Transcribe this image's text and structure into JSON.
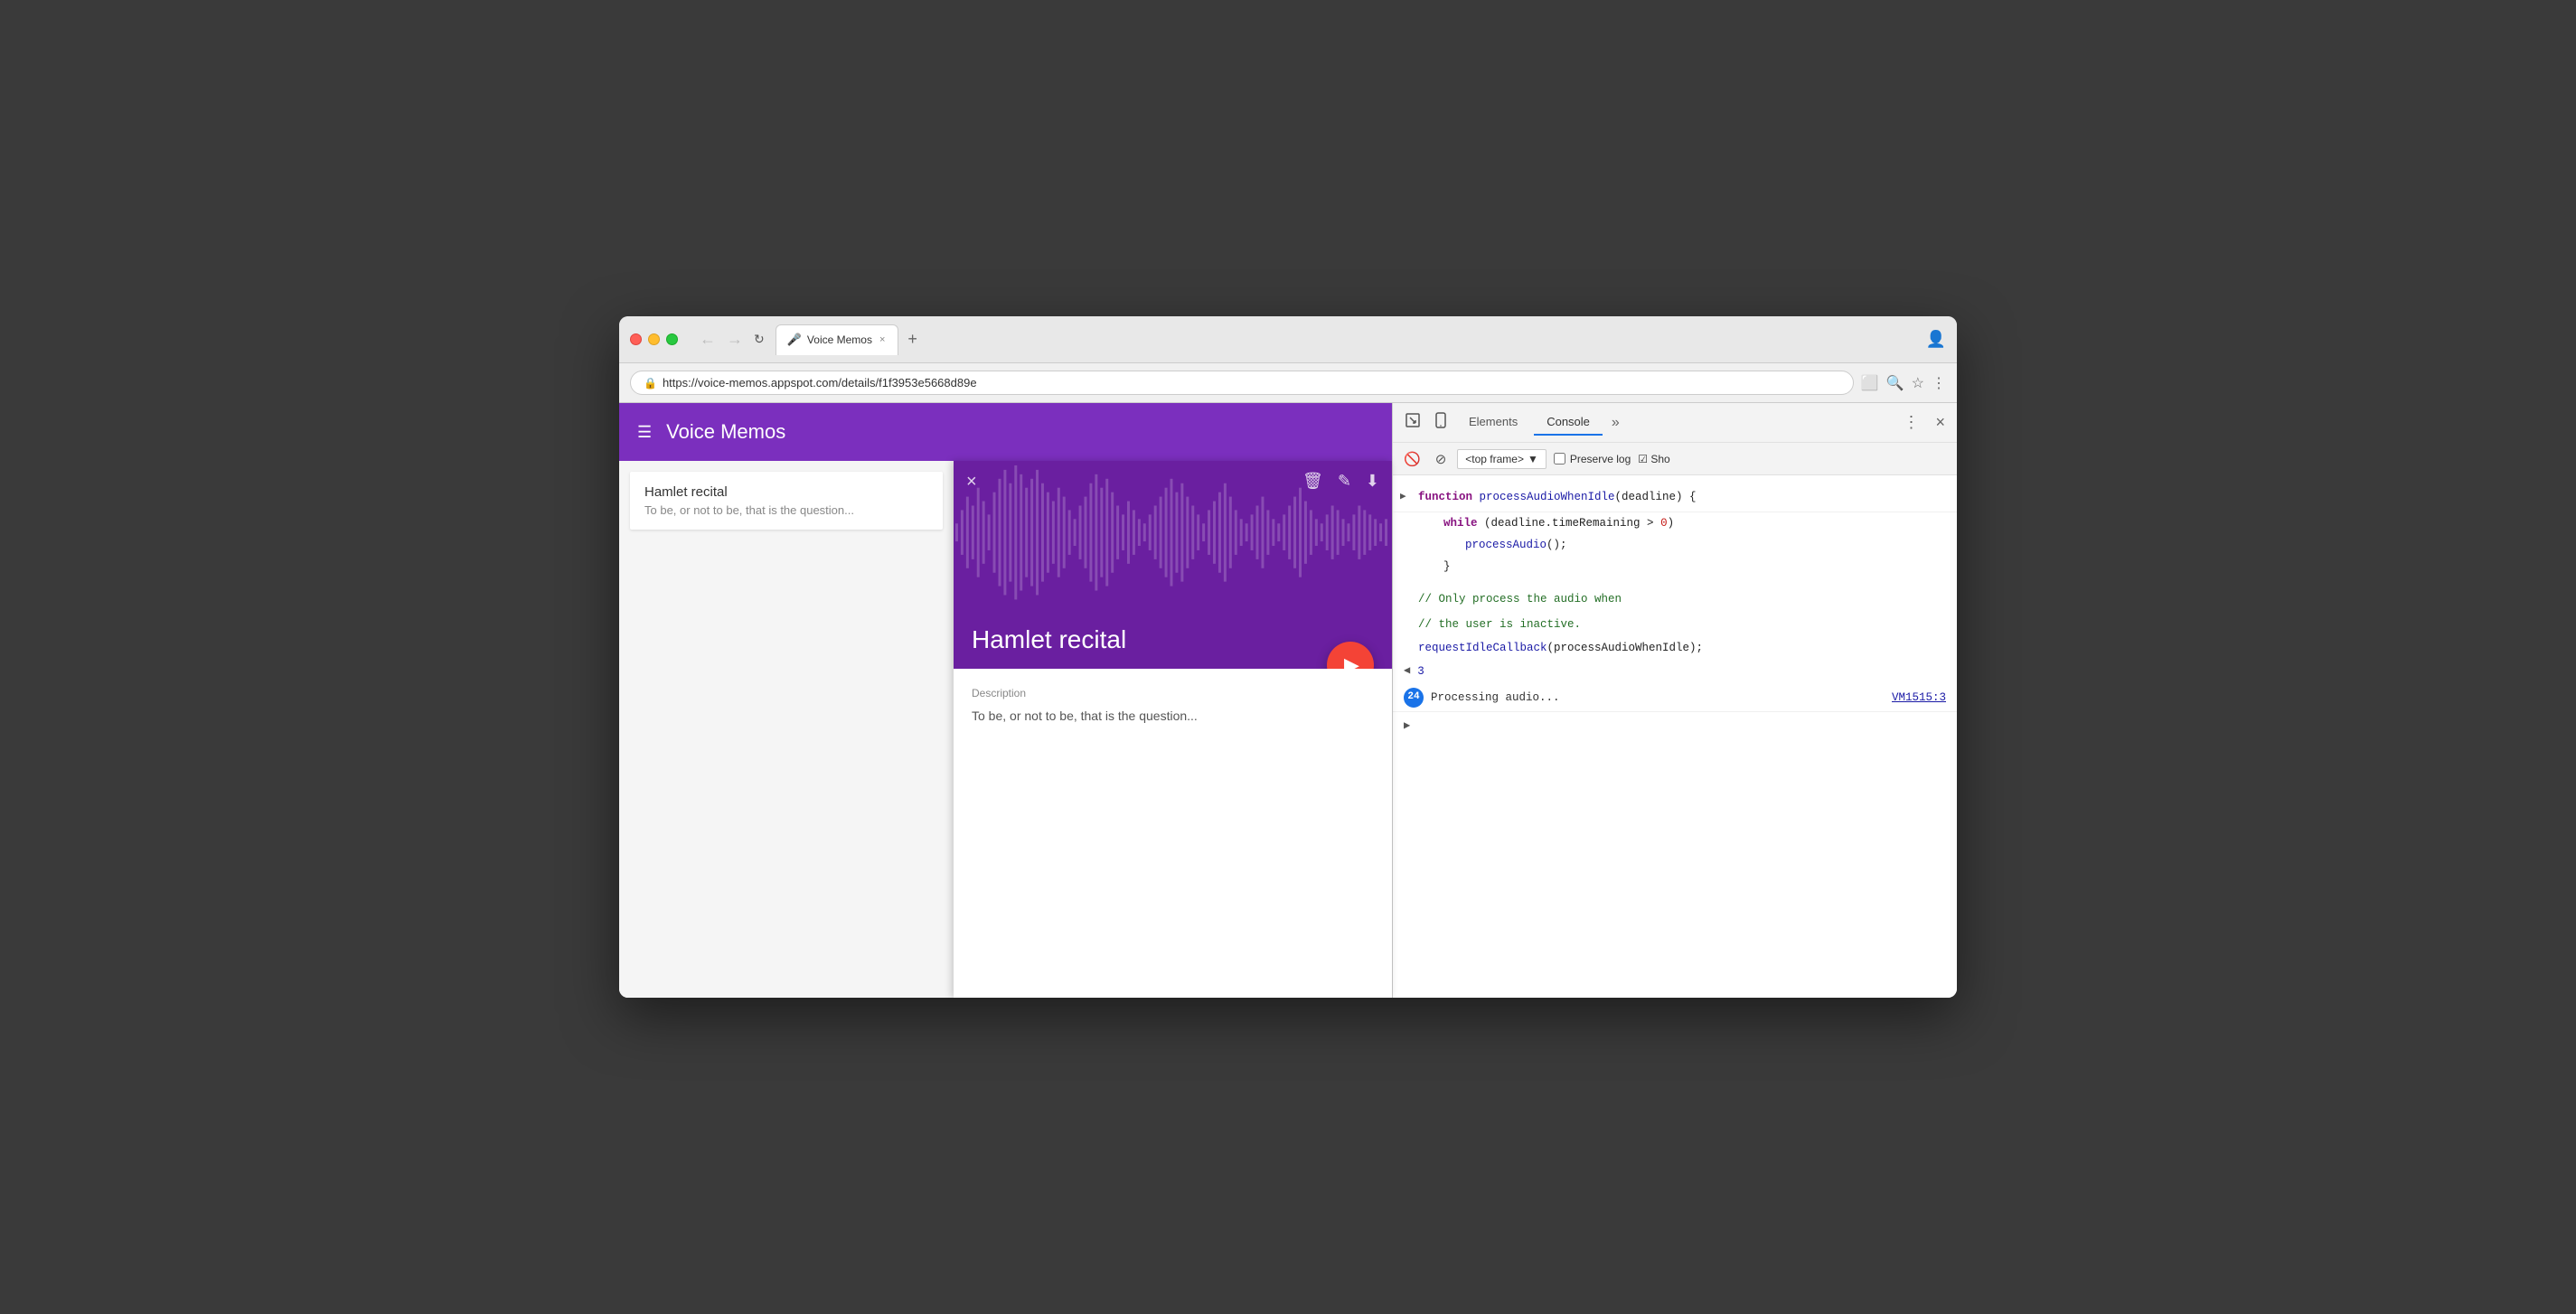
{
  "browser": {
    "traffic_lights": [
      "red",
      "yellow",
      "green"
    ],
    "tab": {
      "icon": "🎤",
      "title": "Voice Memos",
      "close_label": "×"
    },
    "new_tab_label": "+",
    "nav": {
      "back": "←",
      "forward": "→",
      "refresh": "↻"
    },
    "address_bar": {
      "secure_icon": "🔒",
      "url": "https://voice-memos.appspot.com/details/f1f3953e5668d89e"
    },
    "address_icons": [
      "⬜",
      "🔍",
      "★",
      "⋮"
    ]
  },
  "app": {
    "menu_icon": "☰",
    "title": "Voice Memos",
    "memo": {
      "title": "Hamlet recital",
      "description": "To be, or not to be, that is the question..."
    },
    "detail": {
      "close_label": "×",
      "actions": [
        "🗑",
        "✎",
        "⬇"
      ],
      "title": "Hamlet recital",
      "play_icon": "▶",
      "description_label": "Description",
      "description_text": "To be, or not to be, that is the question..."
    }
  },
  "devtools": {
    "tabs": [
      {
        "label": "Elements",
        "active": false
      },
      {
        "label": "Console",
        "active": true
      }
    ],
    "more_label": "»",
    "icons": {
      "more_vert": "⋮",
      "close": "×",
      "inspect": "⬡",
      "mobile": "📱"
    },
    "console_toolbar": {
      "block_icon": "🚫",
      "filter_icon": "⊘",
      "top_frame_label": "<top frame>",
      "dropdown_arrow": "▼",
      "preserve_log": "Preserve log",
      "show_label": "Sho"
    },
    "code": [
      {
        "type": "function_def",
        "arrow": "▶",
        "parts": [
          {
            "text": "function ",
            "class": "kw-purple"
          },
          {
            "text": "processAudioWhenIdle",
            "class": "kw-blue"
          },
          {
            "text": "(deadline) {",
            "class": "code-plain"
          }
        ]
      },
      {
        "type": "indent1",
        "parts": [
          {
            "text": "while ",
            "class": "kw-purple"
          },
          {
            "text": "(deadline.timeRemaining > ",
            "class": "code-plain"
          },
          {
            "text": "0",
            "class": "kw-red"
          },
          {
            "text": ")",
            "class": "code-plain"
          }
        ]
      },
      {
        "type": "indent2",
        "parts": [
          {
            "text": "processAudio",
            "class": "kw-blue"
          },
          {
            "text": "();",
            "class": "code-plain"
          }
        ]
      },
      {
        "type": "indent1",
        "parts": [
          {
            "text": "}",
            "class": "code-plain"
          }
        ]
      },
      {
        "type": "comment",
        "text": "// Only process the audio when"
      },
      {
        "type": "comment",
        "text": "// the user is inactive."
      },
      {
        "type": "plain",
        "parts": [
          {
            "text": "requestIdleCallback",
            "class": "kw-blue"
          },
          {
            "text": "(processAudioWhenIdle);",
            "class": "code-plain"
          }
        ]
      }
    ],
    "result": {
      "arrow": "◀",
      "value": "3"
    },
    "output": {
      "count": "24",
      "text": "Processing audio...",
      "location": "VM1515:3"
    },
    "prompt_arrow": "▶"
  }
}
